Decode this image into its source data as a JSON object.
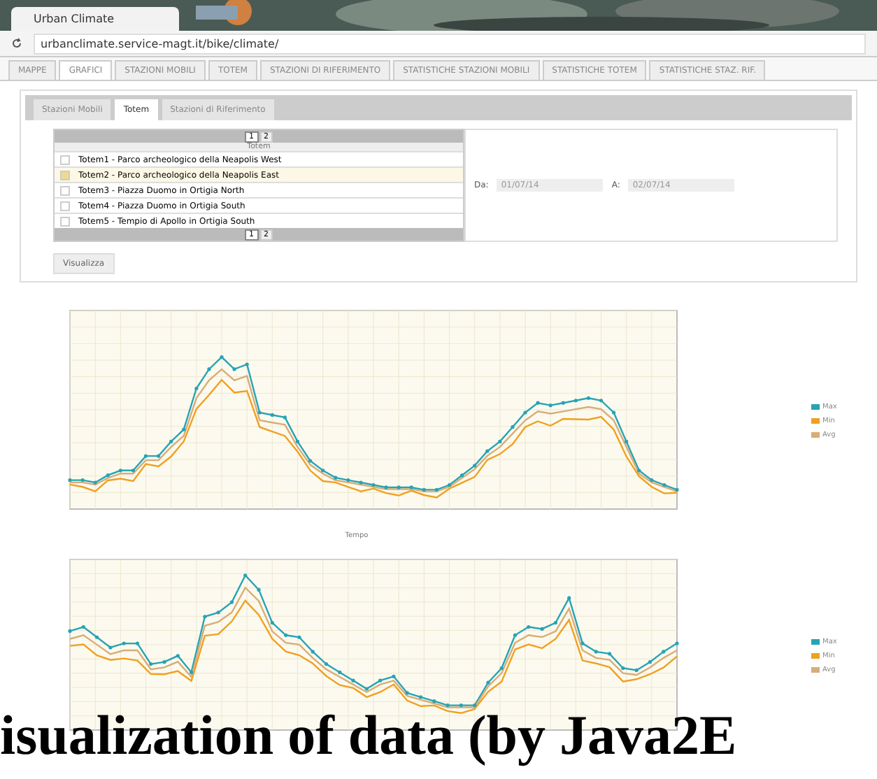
{
  "browser": {
    "tab_title": "Urban Climate",
    "address": "urbanclimate.service-magt.it/bike/climate/"
  },
  "main_tabs": [
    {
      "label": "MAPPE",
      "selected": false
    },
    {
      "label": "GRAFICI",
      "selected": true
    },
    {
      "label": "STAZIONI MOBILI",
      "selected": false
    },
    {
      "label": "TOTEM",
      "selected": false
    },
    {
      "label": "STAZIONI DI RIFERIMENTO",
      "selected": false
    },
    {
      "label": "STATISTICHE STAZIONI MOBILI",
      "selected": false
    },
    {
      "label": "STATISTICHE TOTEM",
      "selected": false
    },
    {
      "label": "STATISTICHE STAZ. RIF.",
      "selected": false
    }
  ],
  "sub_tabs": [
    {
      "label": "Stazioni Mobili",
      "selected": false
    },
    {
      "label": "Totem",
      "selected": true
    },
    {
      "label": "Stazioni di Riferimento",
      "selected": false
    }
  ],
  "table": {
    "pages": [
      {
        "label": "1",
        "selected": true
      },
      {
        "label": "2",
        "selected": false
      }
    ],
    "bottom_pages": [
      {
        "label": "1",
        "selected": true
      },
      {
        "label": "2",
        "selected": false
      }
    ],
    "header": "Totem",
    "rows": [
      {
        "label": "Totem1 - Parco archeologico della Neapolis West",
        "selected": false
      },
      {
        "label": "Totem2 - Parco archeologico della Neapolis East",
        "selected": true
      },
      {
        "label": "Totem3 - Piazza Duomo in Ortigia North",
        "selected": false
      },
      {
        "label": "Totem4 - Piazza Duomo in Ortigia South",
        "selected": false
      },
      {
        "label": "Totem5 - Tempio di Apollo in Ortigia South",
        "selected": false
      }
    ]
  },
  "dates": {
    "from_label": "Da:",
    "from_value": "01/07/14",
    "to_label": "A:",
    "to_value": "02/07/14"
  },
  "button": "Visualizza",
  "charts": [
    {
      "xlabel": "Tempo",
      "legend": [
        "Max",
        "Min",
        "Avg"
      ]
    },
    {
      "legend": [
        "Max",
        "Min",
        "Avg"
      ]
    }
  ],
  "caption": "isualization of data (by Java2E"
}
